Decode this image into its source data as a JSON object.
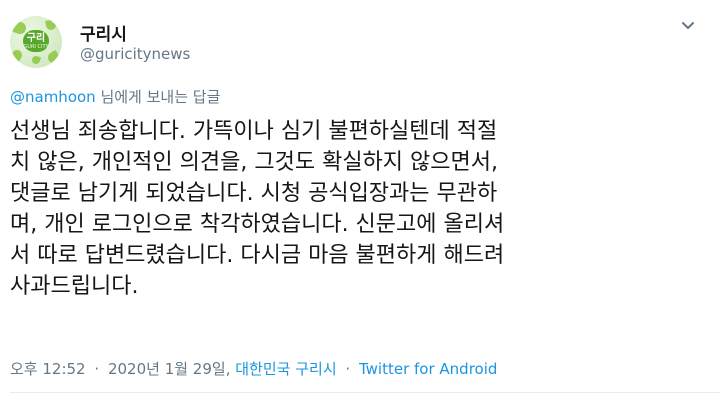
{
  "profile": {
    "name": "구리시",
    "handle": "@guricitynews",
    "avatar_text": "구리",
    "avatar_subtext": "GURI CITY",
    "brand_color": "#58a82b"
  },
  "reply": {
    "mention": "@namhoon",
    "suffix": " 님에게 보내는 답글"
  },
  "tweet": {
    "lines": [
      "선생님 죄송합니다. 가뜩이나 심기 불편하실텐데 적절",
      "치 않은, 개인적인 의견을, 그것도 확실하지 않으면서,",
      "댓글로 남기게 되었습니다. 시청 공식입장과는 무관하",
      "며, 개인 로그인으로 착각하였습니다. 신문고에 올리셔",
      "서 따로 답변드렸습니다. 다시금 마음 불편하게 해드려",
      "사과드립니다."
    ]
  },
  "meta": {
    "time": "오후 12:52",
    "date": "2020년 1월 29일,",
    "location": "대한민국 구리시",
    "source": "Twitter for Android",
    "separator": "·"
  },
  "icons": {
    "caret": "chevron-down-icon"
  },
  "colors": {
    "link": "#1b95e0",
    "muted": "#657786",
    "text": "#14171a"
  }
}
